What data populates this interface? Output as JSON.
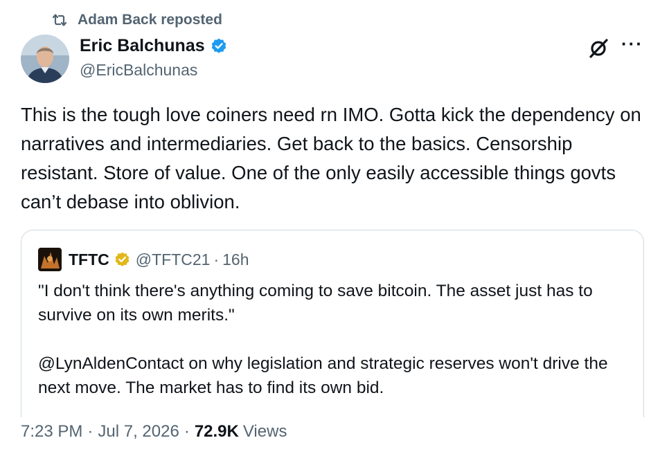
{
  "repost": {
    "icon": "repost-icon",
    "text": "Adam Back reposted"
  },
  "author": {
    "name": "Eric Balchunas",
    "handle": "@EricBalchunas",
    "verified_icon": "verified-badge-icon"
  },
  "actions": {
    "grok_icon": "grok-icon",
    "more_label": "···"
  },
  "tweet": {
    "text": "This is the tough love coiners need rn IMO. Gotta kick the dependency on narratives and intermediaries. Get back to the basics. Censorship resistant. Store of value. One of the only easily accessible things govts can’t debase into oblivion."
  },
  "quote": {
    "name": "TFTC",
    "handle": "@TFTC21",
    "separator": "·",
    "time": "16h",
    "badge_icon": "gold-verified-badge-icon",
    "paragraph1": "\"I don't think there's anything coming to save bitcoin. The asset just has to survive on its own merits.\"",
    "paragraph2": "@LynAldenContact on why legislation and strategic reserves won't drive the next move. The market has to find its own bid."
  },
  "meta": {
    "time": "7:23 PM",
    "sep1": "·",
    "date": "Jul 7, 2026",
    "sep2": "·",
    "views_count": "72.9K",
    "views_label": "Views"
  },
  "colors": {
    "text": "#0f1419",
    "secondary": "#536471",
    "verified_blue": "#1d9bf0",
    "verified_gold": "#e2b719",
    "border": "#cfd9de"
  }
}
